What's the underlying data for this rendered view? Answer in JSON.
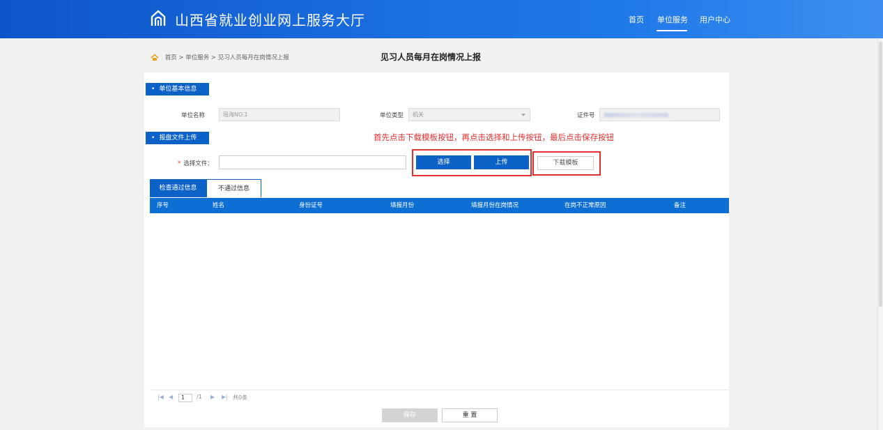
{
  "header": {
    "title": "山西省就业创业网上服务大厅",
    "nav": [
      "首页",
      "单位服务",
      "用户中心"
    ],
    "active_nav": "单位服务"
  },
  "breadcrumb": {
    "text": "首页 > 单位服务 > 见习人员每月在岗情况上报"
  },
  "page_title": "见习人员每月在岗情况上报",
  "unit_info": {
    "section_label": "单位基本信息",
    "name_label": "单位名称",
    "name_value": "瑶海NO.1",
    "type_label": "单位类型",
    "type_value": "机关",
    "cert_label": "证件号"
  },
  "upload": {
    "section_label": "报盘文件上传",
    "hint": "首先点击下载模板按钮，再点击选择和上传按钮，最后点击保存按钮",
    "file_label": "选择文件：",
    "file_value": "",
    "select_button": "选择",
    "upload_button": "上传",
    "download_button": "下载模板"
  },
  "tabs": [
    "检查通过信息",
    "不通过信息"
  ],
  "table": {
    "columns": [
      "序号",
      "姓名",
      "身份证号",
      "填报月份",
      "填报月份在岗情况",
      "在岗不正常原因",
      "备注"
    ],
    "rows": []
  },
  "pager": {
    "current_page": "1",
    "total_pages": "/1",
    "total_records": "共0条"
  },
  "actions": {
    "save": "保存",
    "reset": "重 置"
  },
  "colors": {
    "header_blue": "#1b6ee0",
    "primary_blue": "#0d62c8",
    "hint_red": "#e03030"
  }
}
